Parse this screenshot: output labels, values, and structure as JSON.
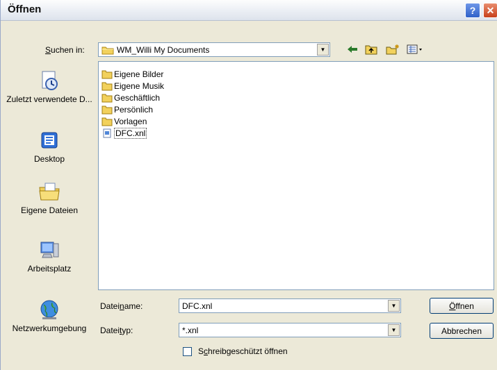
{
  "dialog": {
    "title": "Öffnen",
    "help_label": "?",
    "close_label": "✕"
  },
  "lookin": {
    "label_prefix": "",
    "label_u": "S",
    "label_rest": "uchen in:",
    "value": "WM_Willi My Documents"
  },
  "places": [
    {
      "label": "Zuletzt verwendete D...",
      "icon": "recent-documents-icon"
    },
    {
      "label": "Desktop",
      "icon": "desktop-icon"
    },
    {
      "label": "Eigene Dateien",
      "icon": "my-documents-icon"
    },
    {
      "label": "Arbeitsplatz",
      "icon": "my-computer-icon"
    },
    {
      "label": "Netzwerkumgebung",
      "icon": "network-places-icon"
    }
  ],
  "files": [
    {
      "name": "Eigene Bilder",
      "type": "folder"
    },
    {
      "name": "Eigene Musik",
      "type": "folder"
    },
    {
      "name": "Geschäftlich",
      "type": "folder"
    },
    {
      "name": "Persönlich",
      "type": "folder"
    },
    {
      "name": "Vorlagen",
      "type": "folder"
    },
    {
      "name": "DFC.xnl",
      "type": "file",
      "selected": true
    }
  ],
  "filename": {
    "label_prefix": "Datei",
    "label_u": "n",
    "label_rest": "ame:",
    "value": "DFC.xnl"
  },
  "filetype": {
    "label_prefix": "Datei",
    "label_u": "t",
    "label_rest": "yp:",
    "value": "*.xnl"
  },
  "readonly": {
    "label_prefix": "S",
    "label_u": "c",
    "label_rest": "hreibgeschützt öffnen"
  },
  "buttons": {
    "open_u": "Ö",
    "open_rest": "ffnen",
    "cancel": "Abbrechen"
  },
  "colors": {
    "folder": "#f2d15c",
    "selection": "#316ac5",
    "accent": "#003c74"
  }
}
